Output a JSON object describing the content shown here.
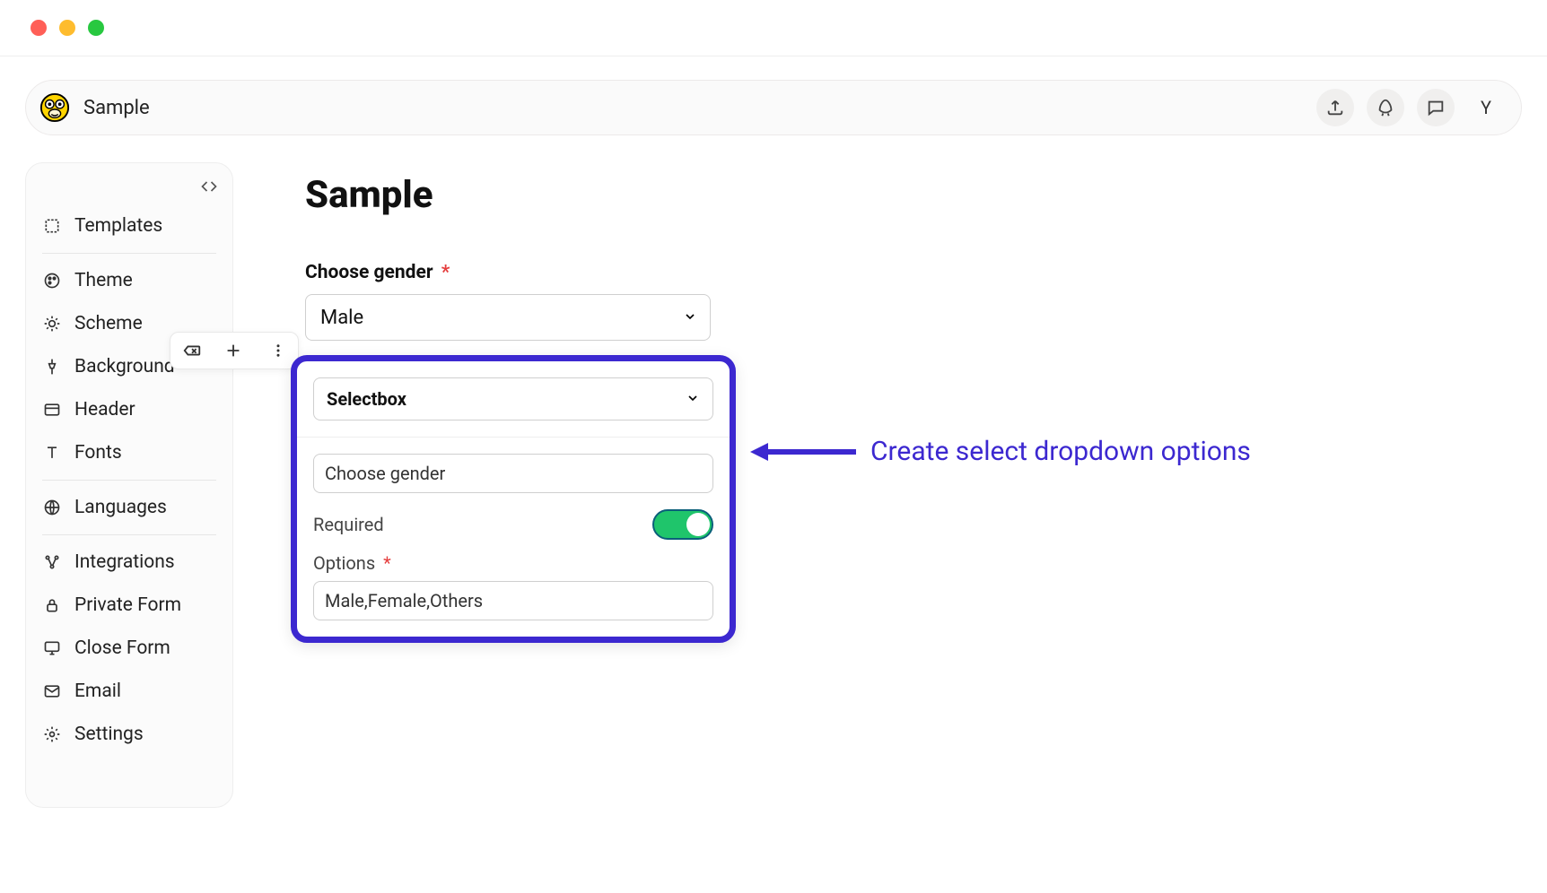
{
  "header": {
    "title": "Sample",
    "avatar_letter": "Y"
  },
  "sidebar": {
    "items": [
      {
        "key": "templates",
        "label": "Templates",
        "icon": "template"
      },
      {
        "key": "theme",
        "label": "Theme",
        "icon": "palette"
      },
      {
        "key": "scheme",
        "label": "Scheme",
        "icon": "sparkle"
      },
      {
        "key": "background",
        "label": "Background",
        "icon": "pin"
      },
      {
        "key": "header",
        "label": "Header",
        "icon": "layout"
      },
      {
        "key": "fonts",
        "label": "Fonts",
        "icon": "text"
      },
      {
        "key": "languages",
        "label": "Languages",
        "icon": "globe"
      },
      {
        "key": "integrations",
        "label": "Integrations",
        "icon": "nodes"
      },
      {
        "key": "private",
        "label": "Private Form",
        "icon": "lock"
      },
      {
        "key": "close",
        "label": "Close Form",
        "icon": "monitor"
      },
      {
        "key": "email",
        "label": "Email",
        "icon": "mail"
      },
      {
        "key": "settings",
        "label": "Settings",
        "icon": "gear"
      }
    ]
  },
  "main": {
    "page_title": "Sample",
    "field_label": "Choose gender",
    "field_required": true,
    "field_selected": "Male"
  },
  "config": {
    "type_label": "Selectbox",
    "question_value": "Choose gender",
    "required_label": "Required",
    "required_on": true,
    "options_label": "Options",
    "options_required": true,
    "options_value": "Male,Female,Others"
  },
  "annotation": {
    "text": "Create select dropdown options"
  },
  "colors": {
    "highlight": "#3c28d0",
    "toggle_on": "#1fc56b"
  }
}
